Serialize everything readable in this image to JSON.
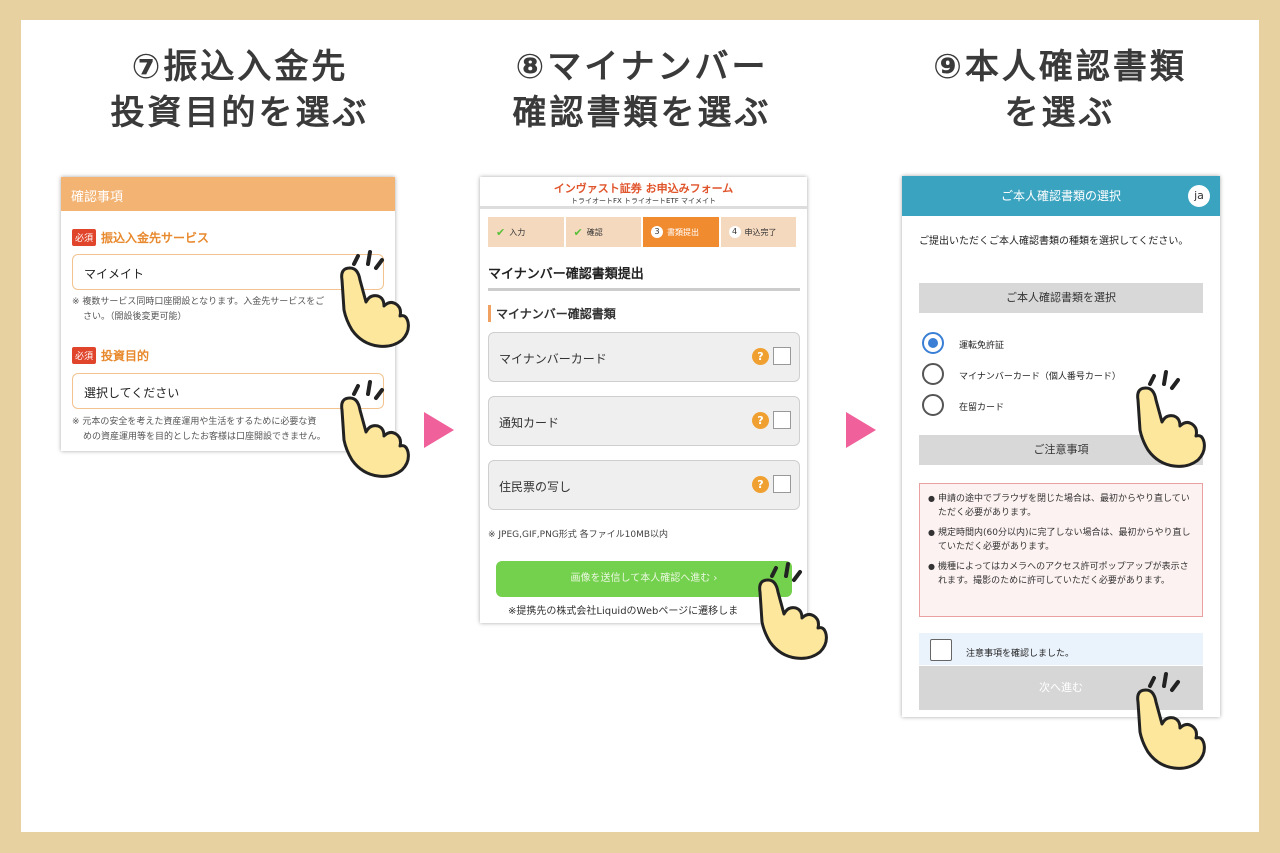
{
  "steps": [
    {
      "title_line1": "⑦振込入金先",
      "title_line2": "投資目的を選ぶ"
    },
    {
      "title_line1": "⑧マイナンバー",
      "title_line2": "確認書類を選ぶ"
    },
    {
      "title_line1": "⑨本人確認書類",
      "title_line2": "を選ぶ"
    }
  ],
  "panel1": {
    "header": "確認事項",
    "required_badge": "必須",
    "service_label": "振込入金先サービス",
    "service_value": "マイメイト",
    "service_note_line1": "※ 複数サービス同時口座開設となります。入金先サービスをご",
    "service_note_line2": "さい。（開設後変更可能）",
    "purpose_label": "投資目的",
    "purpose_value": "選択してください",
    "purpose_note_line1": "※ 元本の安全を考えた資産運用や生活をするために必要な資",
    "purpose_note_line2": "めの資産運用等を目的としたお客様は口座開設できません。"
  },
  "panel2": {
    "brand": "インヴァスト証券 お申込みフォーム",
    "logos": "トライオートFX トライオートETF マイメイト",
    "steps": [
      {
        "num": "",
        "label": "入力",
        "done": true
      },
      {
        "num": "",
        "label": "確認",
        "done": true
      },
      {
        "num": "3",
        "label": "書類提出",
        "done": false
      },
      {
        "num": "4",
        "label": "申込完了",
        "done": false
      }
    ],
    "title": "マイナンバー確認書類提出",
    "subtitle": "マイナンバー確認書類",
    "options": [
      "マイナンバーカード",
      "通知カード",
      "住民票の写し"
    ],
    "help_icon": "?",
    "file_note": "※ JPEG,GIF,PNG形式 各ファイル10MB以内",
    "submit_button": "画像を送信して本人確認へ進む ›",
    "footer_note": "※提携先の株式会社LiquidのWebページに遷移しま"
  },
  "panel3": {
    "header": "ご本人確認書類の選択",
    "avatar": "ja",
    "intro": "ご提出いただくご本人確認書類の種類を選択してください。",
    "select_bar": "ご本人確認書類を選択",
    "options": [
      "運転免許証",
      "マイナンバーカード（個人番号カード）",
      "在留カード"
    ],
    "notice_bar": "ご注意事項",
    "notices": [
      "申請の途中でブラウザを閉じた場合は、最初からやり直していただく必要があります。",
      "規定時間内(60分以内)に完了しない場合は、最初からやり直していただく必要があります。",
      "機種によってはカメラへのアクセス許可ポップアップが表示されます。撮影のために許可していただく必要があります。"
    ],
    "confirm_label": "注意事項を確認しました。",
    "next_button": "次へ進む"
  },
  "colors": {
    "frame": "#e8d1a0",
    "arrow": "#f0609a",
    "orange": "#f3b373",
    "green": "#74d14d",
    "teal": "#3aa3bf"
  }
}
